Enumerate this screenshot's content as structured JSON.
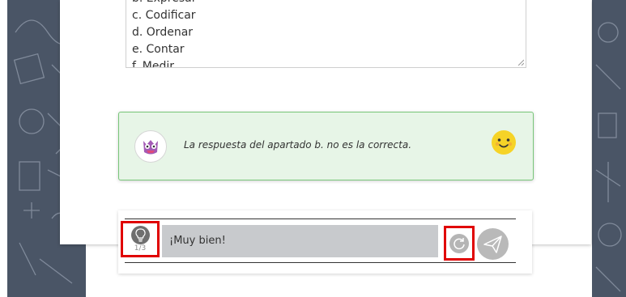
{
  "options_list": {
    "items": [
      "b. Expresar",
      "c. Codificar",
      "d. Ordenar",
      "e. Contar",
      "f. Medir"
    ]
  },
  "feedback": {
    "message": "La respuesta del apartado b. no es la correcta.",
    "avatar_icon": "monster-mascot-icon",
    "mood_icon": "smiley-face-icon"
  },
  "answer_bar": {
    "hint_counter": "1/3",
    "input_value": "¡Muy bien!",
    "hint_icon": "lightbulb-icon",
    "retry_icon": "refresh-icon",
    "send_icon": "paper-plane-icon"
  },
  "colors": {
    "background_pattern": "#4a5566",
    "feedback_bg": "#e7f5e7",
    "feedback_border": "#79c67a",
    "highlight_red": "#e00000",
    "input_bg": "#c8cacd"
  }
}
